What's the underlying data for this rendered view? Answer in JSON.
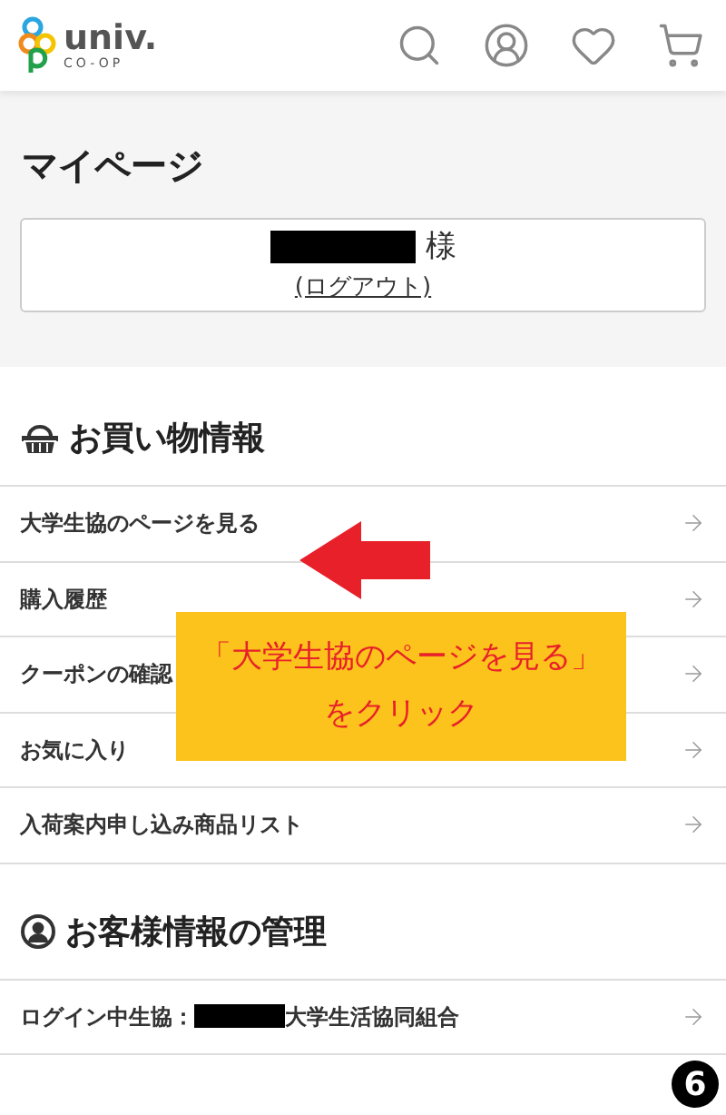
{
  "header": {
    "logo_main": "univ.",
    "logo_sub": "CO-OP"
  },
  "page_title": "マイページ",
  "account": {
    "name_suffix": "様",
    "logout_link": "(ログアウト)"
  },
  "shopping_section": {
    "title": "お買い物情報",
    "items": [
      {
        "label": "大学生協のページを見る"
      },
      {
        "label": "購入履歴"
      },
      {
        "label": "クーポンの確認"
      },
      {
        "label": "お気に入り"
      },
      {
        "label": "入荷案内申し込み商品リスト"
      }
    ]
  },
  "customer_section": {
    "title": "お客様情報の管理",
    "items": [
      {
        "prefix": "ログイン中生協：",
        "suffix": "大学生活協同組合"
      }
    ]
  },
  "callout": {
    "line1": "「大学生協のページを見る」",
    "line2": "をクリック"
  },
  "step_badge": "6"
}
